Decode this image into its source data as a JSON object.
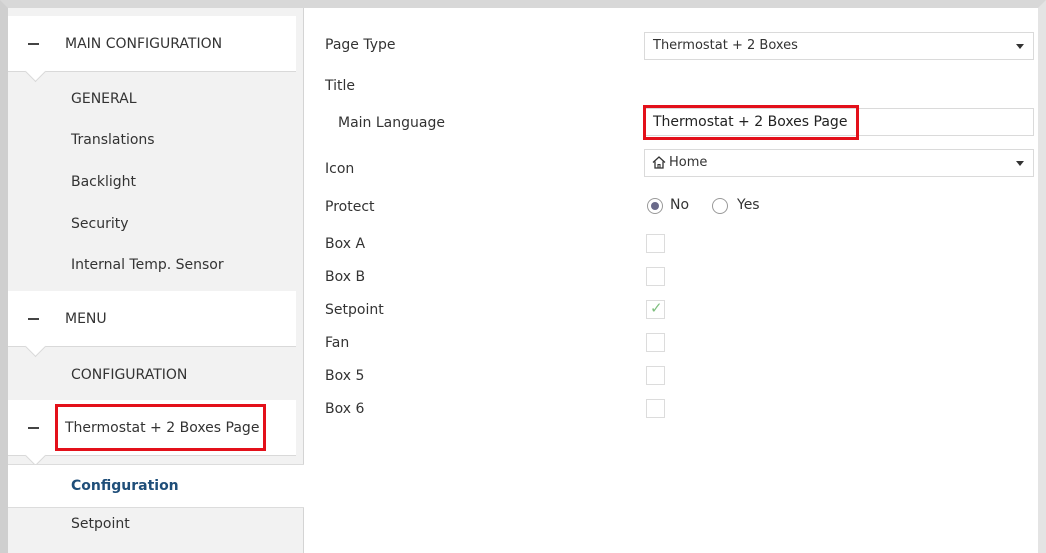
{
  "sidebar": {
    "groups": [
      {
        "label": "MAIN CONFIGURATION",
        "items": [
          "GENERAL",
          "Translations",
          "Backlight",
          "Security",
          "Internal Temp. Sensor"
        ]
      },
      {
        "label": "MENU",
        "items": [
          "CONFIGURATION"
        ]
      },
      {
        "label": "Thermostat + 2 Boxes Page",
        "items": [
          "Configuration",
          "Setpoint"
        ]
      }
    ],
    "active_item": "Configuration"
  },
  "form": {
    "page_type": {
      "label": "Page Type",
      "value": "Thermostat + 2 Boxes"
    },
    "title": {
      "label": "Title"
    },
    "main_language": {
      "label": "Main Language",
      "value": "Thermostat + 2 Boxes Page"
    },
    "icon": {
      "label": "Icon",
      "value": "Home",
      "icon_name": "home-icon"
    },
    "protect": {
      "label": "Protect",
      "options": [
        "No",
        "Yes"
      ],
      "selected": "No"
    },
    "boxes": [
      {
        "label": "Box A",
        "checked": false
      },
      {
        "label": "Box B",
        "checked": false
      },
      {
        "label": "Setpoint",
        "checked": true
      },
      {
        "label": "Fan",
        "checked": false
      },
      {
        "label": "Box 5",
        "checked": false
      },
      {
        "label": "Box 6",
        "checked": false
      }
    ]
  },
  "colors": {
    "highlight_border": "#e3101a",
    "active_text": "#1f4e79",
    "check_color": "#7fbf7f"
  }
}
